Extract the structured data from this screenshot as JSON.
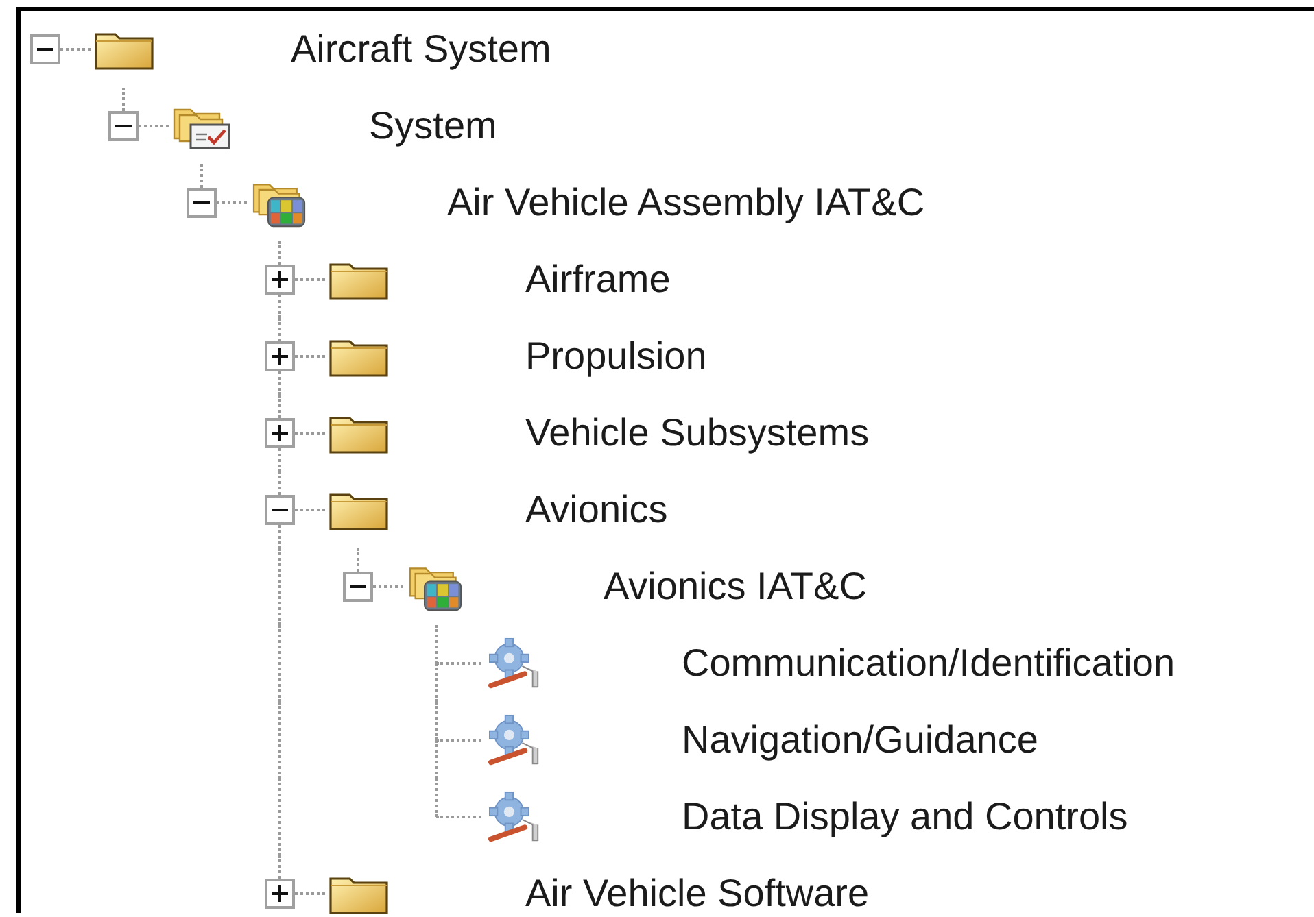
{
  "tree": [
    {
      "label": "Aircraft System",
      "kind": "folder",
      "expanded": true,
      "children": [
        {
          "label": "System",
          "kind": "checklist-folder",
          "expanded": true,
          "children": [
            {
              "label": "Air Vehicle Assembly IAT&C",
              "kind": "cube-folder",
              "expanded": true,
              "children": [
                {
                  "label": "Airframe",
                  "kind": "folder",
                  "expanded": false
                },
                {
                  "label": "Propulsion",
                  "kind": "folder",
                  "expanded": false
                },
                {
                  "label": "Vehicle Subsystems",
                  "kind": "folder",
                  "expanded": false
                },
                {
                  "label": "Avionics",
                  "kind": "folder",
                  "expanded": true,
                  "children": [
                    {
                      "label": "Avionics IAT&C",
                      "kind": "cube-folder",
                      "expanded": true,
                      "children": [
                        {
                          "label": "Communication/Identification",
                          "kind": "gear"
                        },
                        {
                          "label": "Navigation/Guidance",
                          "kind": "gear"
                        },
                        {
                          "label": "Data Display and Controls",
                          "kind": "gear"
                        }
                      ]
                    }
                  ]
                },
                {
                  "label": "Air Vehicle Software",
                  "kind": "folder",
                  "expanded": false
                }
              ]
            }
          ]
        }
      ]
    }
  ]
}
